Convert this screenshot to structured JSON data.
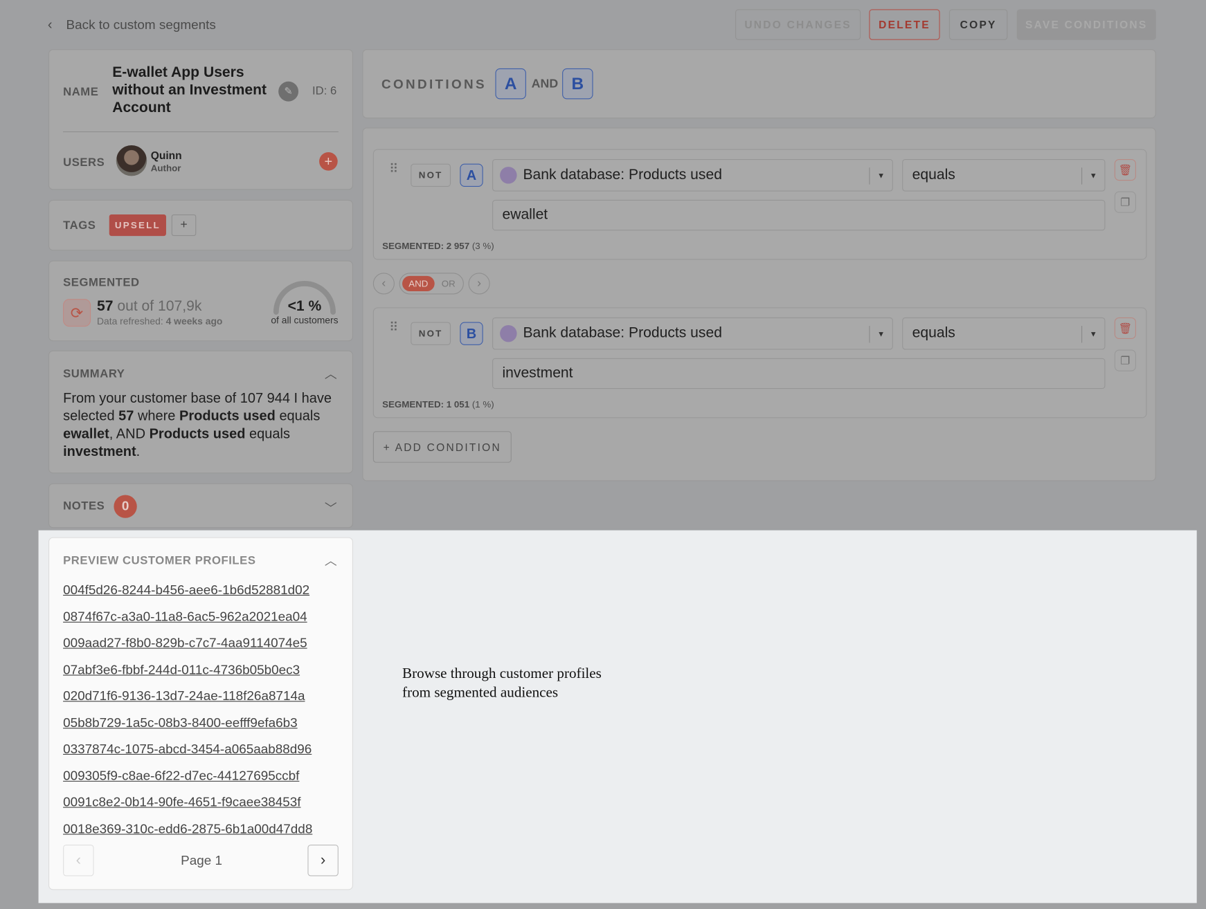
{
  "header": {
    "back_label": "Back to custom segments",
    "buttons": {
      "undo": "UNDO CHANGES",
      "delete": "DELETE",
      "copy": "COPY",
      "save": "SAVE CONDITIONS"
    }
  },
  "segment": {
    "name_label": "NAME",
    "name": "E-wallet App Users without an Investment Account",
    "id": "ID: 6",
    "users_label": "USERS",
    "user_name": "Quinn",
    "user_role": "Author",
    "tags_label": "TAGS",
    "tags": [
      "UPSELL"
    ]
  },
  "segmented": {
    "label": "SEGMENTED",
    "count": "57",
    "out_of": "out of 107,9k",
    "refreshed_prefix": "Data refreshed:",
    "refreshed_value": "4 weeks ago",
    "percent": "<1 %",
    "percent_caption": "of all customers",
    "gauge_fraction": 0.005
  },
  "summary": {
    "label": "SUMMARY",
    "t1": "From your customer base of 107 944 I have selected ",
    "b1": "57",
    "t2": " where ",
    "b2": "Products used",
    "t3": " equals ",
    "b3": "ewallet",
    "t4": ", AND ",
    "b4": "Products used",
    "t5": " equals ",
    "b5": "investment",
    "t6": "."
  },
  "notes": {
    "label": "NOTES",
    "count": "0"
  },
  "conditions": {
    "label": "CONDITIONS",
    "expr": [
      "A",
      "AND",
      "B"
    ],
    "items": [
      {
        "not": "NOT",
        "letter": "A",
        "field": "Bank database: Products used",
        "operator": "equals",
        "value": "ewallet",
        "seg_label": "SEGMENTED:",
        "seg_count": "2 957",
        "seg_pct": "(3 %)"
      },
      {
        "not": "NOT",
        "letter": "B",
        "field": "Bank database: Products used",
        "operator": "equals",
        "value": "investment",
        "seg_label": "SEGMENTED:",
        "seg_count": "1 051",
        "seg_pct": "(1 %)"
      }
    ],
    "toggle": {
      "and": "AND",
      "or": "OR",
      "selected": "AND"
    },
    "add_label": "+ ADD CONDITION"
  },
  "preview": {
    "label": "PREVIEW CUSTOMER PROFILES",
    "ids": [
      "004f5d26-8244-b456-aee6-1b6d52881d02",
      "0874f67c-a3a0-11a8-6ac5-962a2021ea04",
      "009aad27-f8b0-829b-c7c7-4aa9114074e5",
      "07abf3e6-fbbf-244d-011c-4736b05b0ec3",
      "020d71f6-9136-13d7-24ae-118f26a8714a",
      "05b8b729-1a5c-08b3-8400-eefff9efa6b3",
      "0337874c-1075-abcd-3454-a065aab88d96",
      "009305f9-c8ae-6f22-d7ec-44127695ccbf",
      "0091c8e2-0b14-90fe-4651-f9caee38453f",
      "0018e369-310c-edd6-2875-6b1a00d47dd8"
    ],
    "page": "Page 1"
  },
  "tooltip": {
    "line1": "Browse through customer profiles",
    "line2": "from segmented audiences"
  },
  "colors": {
    "accent": "#c0564a",
    "letter_blue": "#2c4fa0",
    "overlay": "#9fa0a2",
    "spotlight": "#eceef0"
  }
}
